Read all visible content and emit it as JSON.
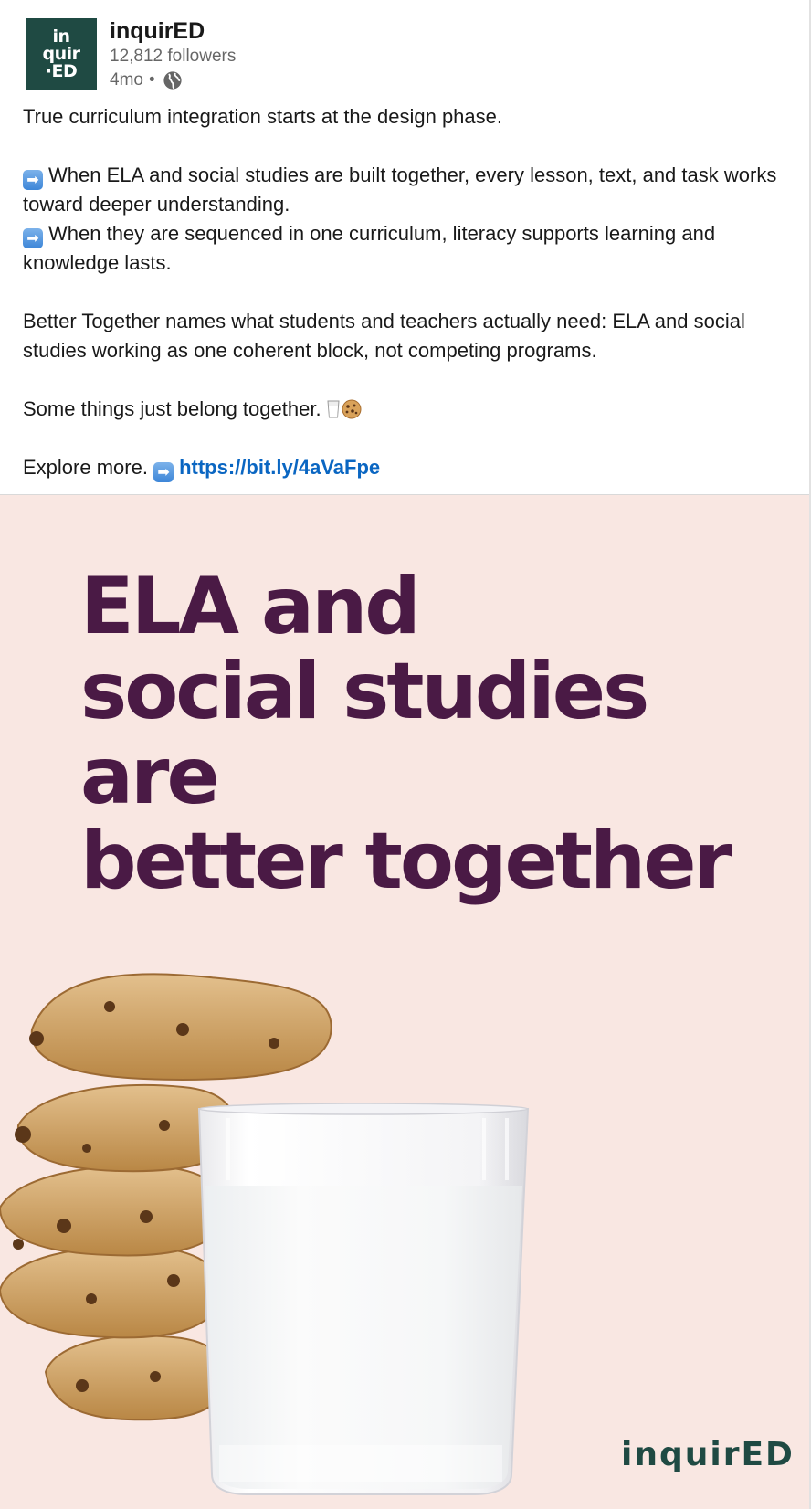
{
  "company": {
    "logo_lines": [
      "in",
      "quir",
      "·ED"
    ],
    "name": "inquirED",
    "followers": "12,812 followers",
    "time": "4mo",
    "separator": "•"
  },
  "post": {
    "line_intro": "True curriculum integration starts at the design phase.",
    "bullet_1": "When ELA and social studies are built together, every lesson, text, and task works toward deeper understanding.",
    "bullet_2": "When they are sequenced in one curriculum, literacy supports learning and knowledge lasts.",
    "paragraph_2": "Better Together names what students and teachers actually need: ELA and social studies working as one coherent block, not competing programs.",
    "line_together": "Some things just belong together.",
    "explore_label": "Explore more.",
    "link_text": "https://bit.ly/4aVaFpe",
    "arrow_glyph": "➡"
  },
  "image": {
    "headline_lines": [
      "ELA and",
      "social studies",
      "are",
      "better together"
    ],
    "brand_mark": "inquirED",
    "background_color": "#f9e7e2",
    "headline_color": "#4a1a45"
  },
  "icons": [
    "globe-icon",
    "arrow-right-emoji",
    "milk-emoji",
    "cookie-emoji"
  ]
}
